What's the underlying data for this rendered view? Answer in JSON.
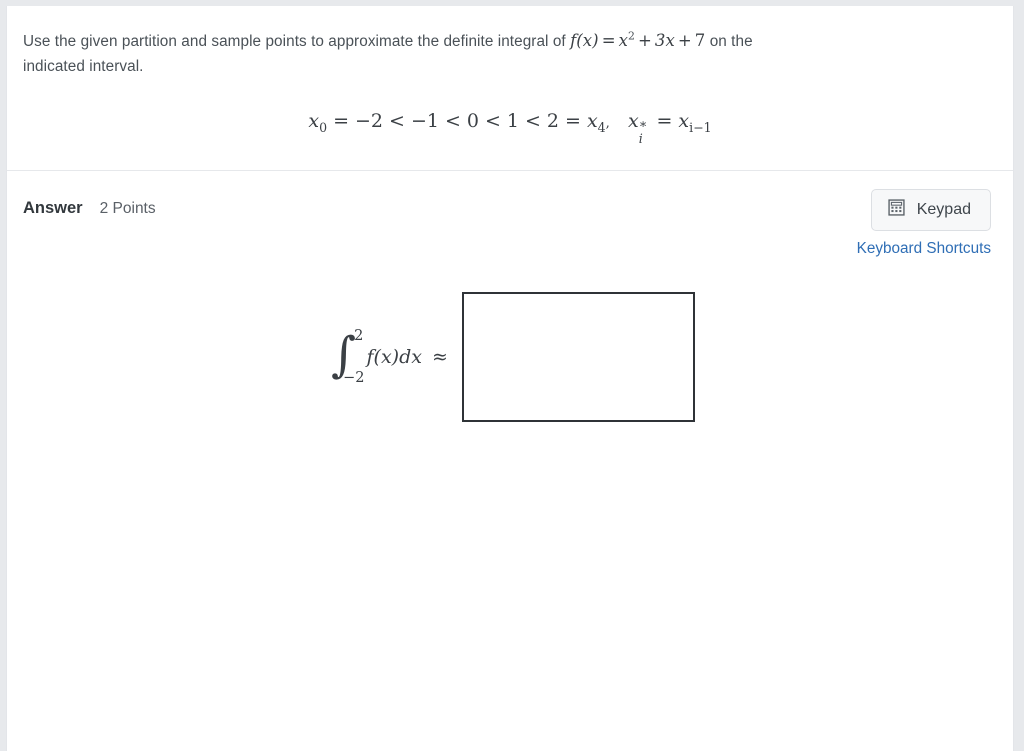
{
  "question": {
    "prompt_before_math": "Use the given partition and sample points to approximate the definite integral of",
    "function_label": "f",
    "function_arg": "(x)",
    "equals": "=",
    "term_x": "x",
    "term_x_exponent": "2",
    "plus1": "+",
    "term_3x": "3x",
    "plus2": "+",
    "term_7": "7",
    "prompt_after_math": "on the",
    "prompt_line2": "indicated interval.",
    "partition": {
      "x0_var": "x",
      "x0_sub": "0",
      "eq1": "=",
      "v1": "−2",
      "lt1": "<",
      "v2": "−1",
      "lt2": "<",
      "v3": "0",
      "lt3": "<",
      "v4": "1",
      "lt4": "<",
      "v5": "2",
      "eq2": "=",
      "x4_var": "x",
      "x4_sub": "4",
      "comma": ",",
      "xstar_var": "x",
      "xstar_sup": "∗",
      "xstar_sub": "i",
      "eq3": "=",
      "sample_var": "x",
      "sample_sub": "i−1"
    }
  },
  "answer": {
    "label": "Answer",
    "points": "2 Points",
    "keypad_button_label": "Keypad",
    "keypad_icon": "calculator-icon",
    "keyboard_shortcuts_label": "Keyboard Shortcuts",
    "integral": {
      "sign": "∫",
      "upper_limit": "2",
      "lower_limit": "−2",
      "integrand": "f(x)dx",
      "relation": "≈"
    },
    "input_value": "",
    "input_placeholder": ""
  },
  "colors": {
    "link": "#2f6eb5",
    "text": "#4a5157",
    "heading": "#32383d",
    "box_border": "#2f3337",
    "button_bg": "#f7f8f9",
    "button_border": "#dcdfe3",
    "page_bg": "#e7e9ec",
    "card_bg": "#ffffff",
    "divider": "#e6e8eb"
  }
}
